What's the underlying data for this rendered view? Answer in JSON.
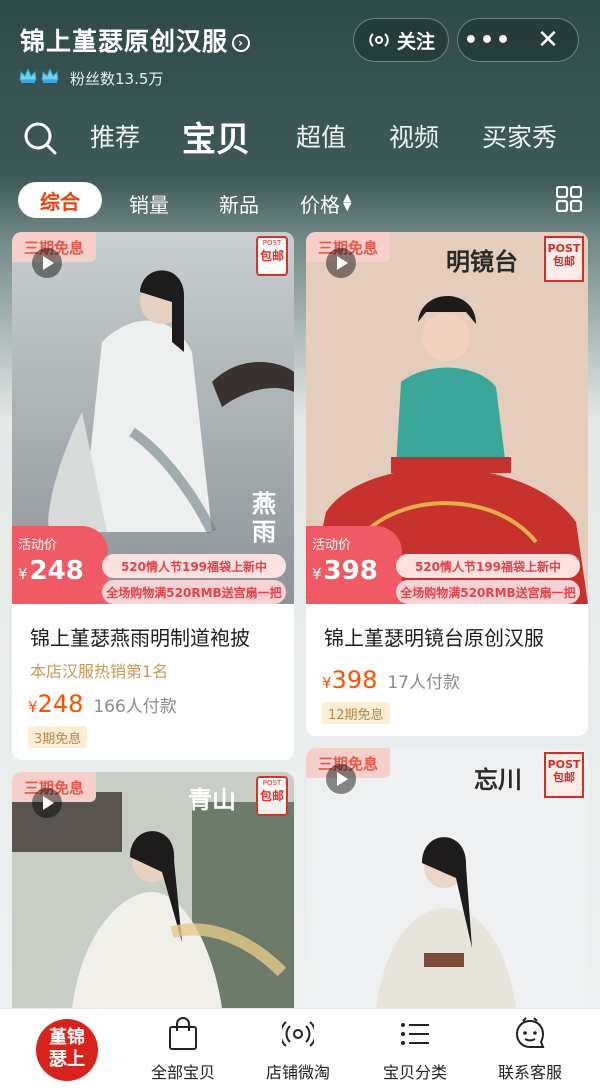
{
  "header": {
    "shop_name": "锦上堇瑟原创汉服",
    "fans": "粉丝数13.5万",
    "follow_label": "关注",
    "more_label": "•••",
    "close_label": "✕"
  },
  "tabs": [
    {
      "label": "推荐"
    },
    {
      "label": "宝贝",
      "active": true
    },
    {
      "label": "超值"
    },
    {
      "label": "视频"
    },
    {
      "label": "买家秀"
    }
  ],
  "sort": {
    "items": [
      {
        "label": "综合",
        "active": true
      },
      {
        "label": "销量"
      },
      {
        "label": "新品"
      },
      {
        "label": "价格"
      }
    ],
    "price_arrows": "▲▼"
  },
  "products": [
    {
      "install_badge": "三期免息",
      "post_tag": {
        "top": "POST",
        "bottom": "包邮"
      },
      "image_title": "燕雨",
      "activity_label": "活动价",
      "activity_currency": "¥",
      "activity_price": "248",
      "promo_line1": "520情人节199福袋上新中",
      "promo_line2": "全场购物满520RMB送宫扇一把",
      "title": "锦上堇瑟燕雨明制道袍披",
      "rank": "本店汉服热销第1名",
      "currency": "¥",
      "price": "248",
      "sold": "166人付款",
      "free_tag": "3期免息"
    },
    {
      "install_badge": "三期免息",
      "post_tag": {
        "top": "POST",
        "bottom": "包邮"
      },
      "image_title": "明镜台",
      "activity_label": "活动价",
      "activity_currency": "¥",
      "activity_price": "398",
      "promo_line1": "520情人节199福袋上新中",
      "promo_line2": "全场购物满520RMB送宫扇一把",
      "title": "锦上堇瑟明镜台原创汉服",
      "currency": "¥",
      "price": "398",
      "sold": "17人付款",
      "free_tag": "12期免息"
    },
    {
      "install_badge": "三期免息",
      "post_tag": {
        "top": "POST",
        "bottom": "包邮"
      },
      "image_title": "青山"
    },
    {
      "install_badge": "三期免息",
      "post_tag": {
        "top": "POST",
        "bottom": "包邮"
      },
      "image_title": "忘川"
    }
  ],
  "bottom_nav": {
    "logo_text": "堇锦瑟上",
    "items": [
      {
        "label": "全部宝贝",
        "icon": "bag-icon"
      },
      {
        "label": "店铺微淘",
        "icon": "broadcast-icon"
      },
      {
        "label": "宝贝分类",
        "icon": "list-icon"
      },
      {
        "label": "联系客服",
        "icon": "chat-icon"
      }
    ]
  },
  "colors": {
    "accent": "#ff5000",
    "header_bg": "#2f4a48",
    "promo_red": "#ef5a64",
    "seal_red": "#d8322a"
  }
}
